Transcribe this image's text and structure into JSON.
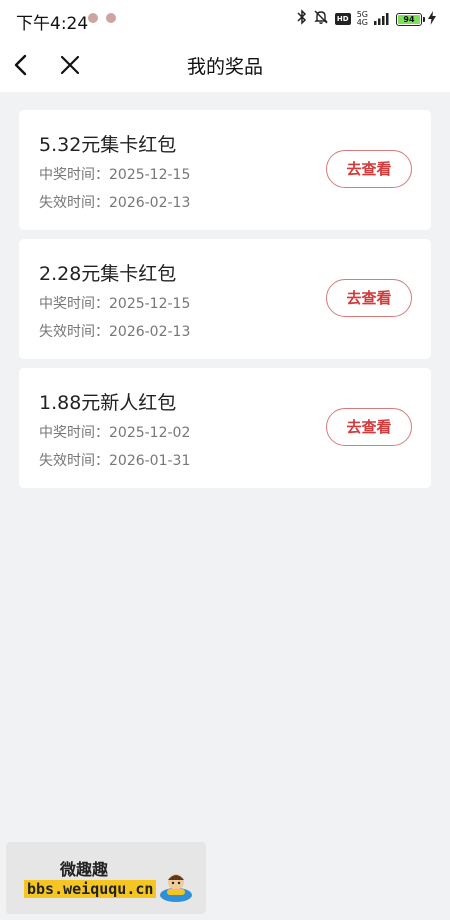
{
  "status_bar": {
    "time": "下午4:24",
    "network_label_top": "5G",
    "network_label_bottom": "4G",
    "hd_label": "HD",
    "battery": "94",
    "icons": [
      "bluetooth-icon",
      "bell-muted-icon",
      "hd-icon",
      "signal-icon",
      "battery-icon",
      "charging-icon"
    ]
  },
  "nav": {
    "title": "我的奖品",
    "icons": [
      "back-arrow-icon",
      "close-icon"
    ]
  },
  "prizes": [
    {
      "name": "5.32元集卡红包",
      "won": "中奖时间：2025-12-15",
      "expire": "失效时间：2026-02-13",
      "button": "去查看"
    },
    {
      "name": "2.28元集卡红包",
      "won": "中奖时间：2025-12-15",
      "expire": "失效时间：2026-02-13",
      "button": "去查看"
    },
    {
      "name": "1.88元新人红包",
      "won": "中奖时间：2025-12-02",
      "expire": "失效时间：2026-01-31",
      "button": "去查看"
    }
  ],
  "watermark": {
    "top_text": "微趣趣",
    "url": "bbs.weiququ.cn"
  },
  "colors": {
    "accent": "#d23b3b",
    "page_background": "#f1f2f4",
    "card_background": "#ffffff",
    "battery": "#7ee05a"
  }
}
